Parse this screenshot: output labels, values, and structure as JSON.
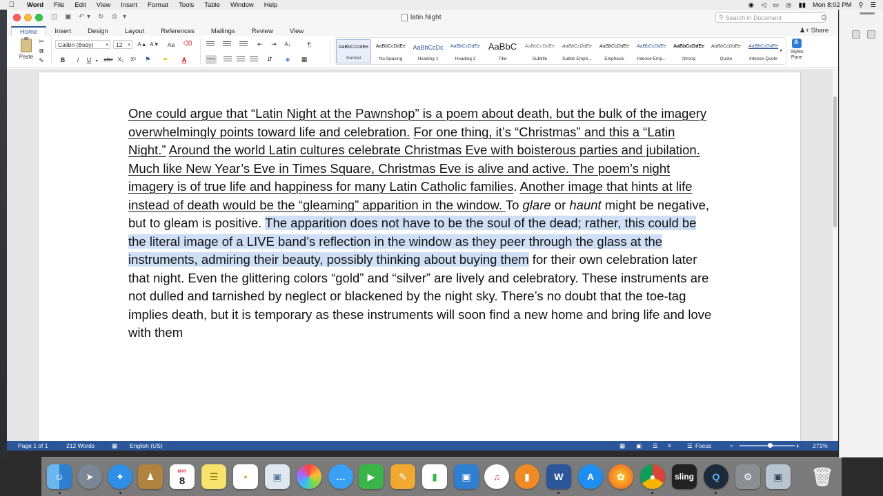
{
  "menubar": {
    "app": "Word",
    "items": [
      "File",
      "Edit",
      "View",
      "Insert",
      "Format",
      "Tools",
      "Table",
      "Window",
      "Help"
    ],
    "clock": "Mon 8:02 PM"
  },
  "window": {
    "title": "latin Night",
    "search_placeholder": "Search in Document",
    "share_label": "Share"
  },
  "ribbon": {
    "tabs": [
      "Home",
      "Insert",
      "Design",
      "Layout",
      "References",
      "Mailings",
      "Review",
      "View"
    ],
    "active_tab": "Home",
    "paste_label": "Paste",
    "font_name": "Calibri (Body)",
    "font_size": "12",
    "bold": "B",
    "italic": "I",
    "underline": "U",
    "strike": "abc",
    "subscript": "X₂",
    "superscript": "X²",
    "font_color": "A",
    "grow_font": "A▲",
    "shrink_font": "A▼",
    "case": "Aa",
    "paragraph_mark": "¶",
    "styles": [
      {
        "sample": "AaBbCcDdEe",
        "name": "Normal"
      },
      {
        "sample": "AaBbCcDdEe",
        "name": "No Spacing"
      },
      {
        "sample": "AaBbCcDc",
        "name": "Heading 1"
      },
      {
        "sample": "AaBbCcDdEe",
        "name": "Heading 2"
      },
      {
        "sample": "AaBbC",
        "name": "Title"
      },
      {
        "sample": "AaBbCcDdEe",
        "name": "Subtitle"
      },
      {
        "sample": "AaBbCcDdEe",
        "name": "Subtle Emph..."
      },
      {
        "sample": "AaBbCcDdEe",
        "name": "Emphasis"
      },
      {
        "sample": "AaBbCcDdEe",
        "name": "Intense Emp..."
      },
      {
        "sample": "AaBbCcDdEe",
        "name": "Strong"
      },
      {
        "sample": "AaBbCcDdEe",
        "name": "Quote"
      },
      {
        "sample": "AaBbCcDdEe",
        "name": "Intense Quote"
      }
    ],
    "styles_pane_label": "Styles Pane"
  },
  "document": {
    "s1": "One could argue that “Latin Night at the Pawnshop” is a poem about death, but the bulk of the imagery overwhelmingly points toward life and celebration.",
    "s2": "For one thing, it’s “Christmas” and this a “Latin Night.”",
    "s3": "Around the world Latin cultures celebrate Christmas Eve with boisterous parties and jubilation. Much like New Year’s Eve in Times Square, Christmas Eve is alive and active. The poem’s night imagery is of true life and happiness for many Latin Catholic families",
    "s3_end": ". ",
    "s4": "Another image that hints at life instead of death would be the “gleaming” apparition in the window. ",
    "s5a": "To ",
    "s5_glare": "glare",
    "s5b": " or ",
    "s5_haunt": "haunt",
    "s5c": " might be negative, but to gleam is positive. ",
    "s6": "The apparition does not have to be the soul of the dead; rather, this could be the literal image of a LIVE band’s reflection in the window as they peer through the glass at the instruments, admiring their beauty, possibly thinking about buying them",
    "s7": " for their own celebration later that night. Even the glittering colors “gold” and “silver” are lively and celebratory. These instruments are not dulled and tarnished by neglect or blackened by the night sky. There’s no doubt that the toe-tag implies death, but it is temporary as these instruments will soon find a new home and bring life and love with them"
  },
  "statusbar": {
    "page": "Page 1 of 1",
    "words": "212 Words",
    "language": "English (US)",
    "focus": "Focus",
    "zoom": "271%",
    "zoom_level_fraction": 0.55
  },
  "dock": {
    "calendar_month": "MAY",
    "calendar_day": "8",
    "sling_label": "sling",
    "word_label": "W"
  },
  "colors": {
    "accent": "#2b579a",
    "selection": "#cfe0f6"
  }
}
